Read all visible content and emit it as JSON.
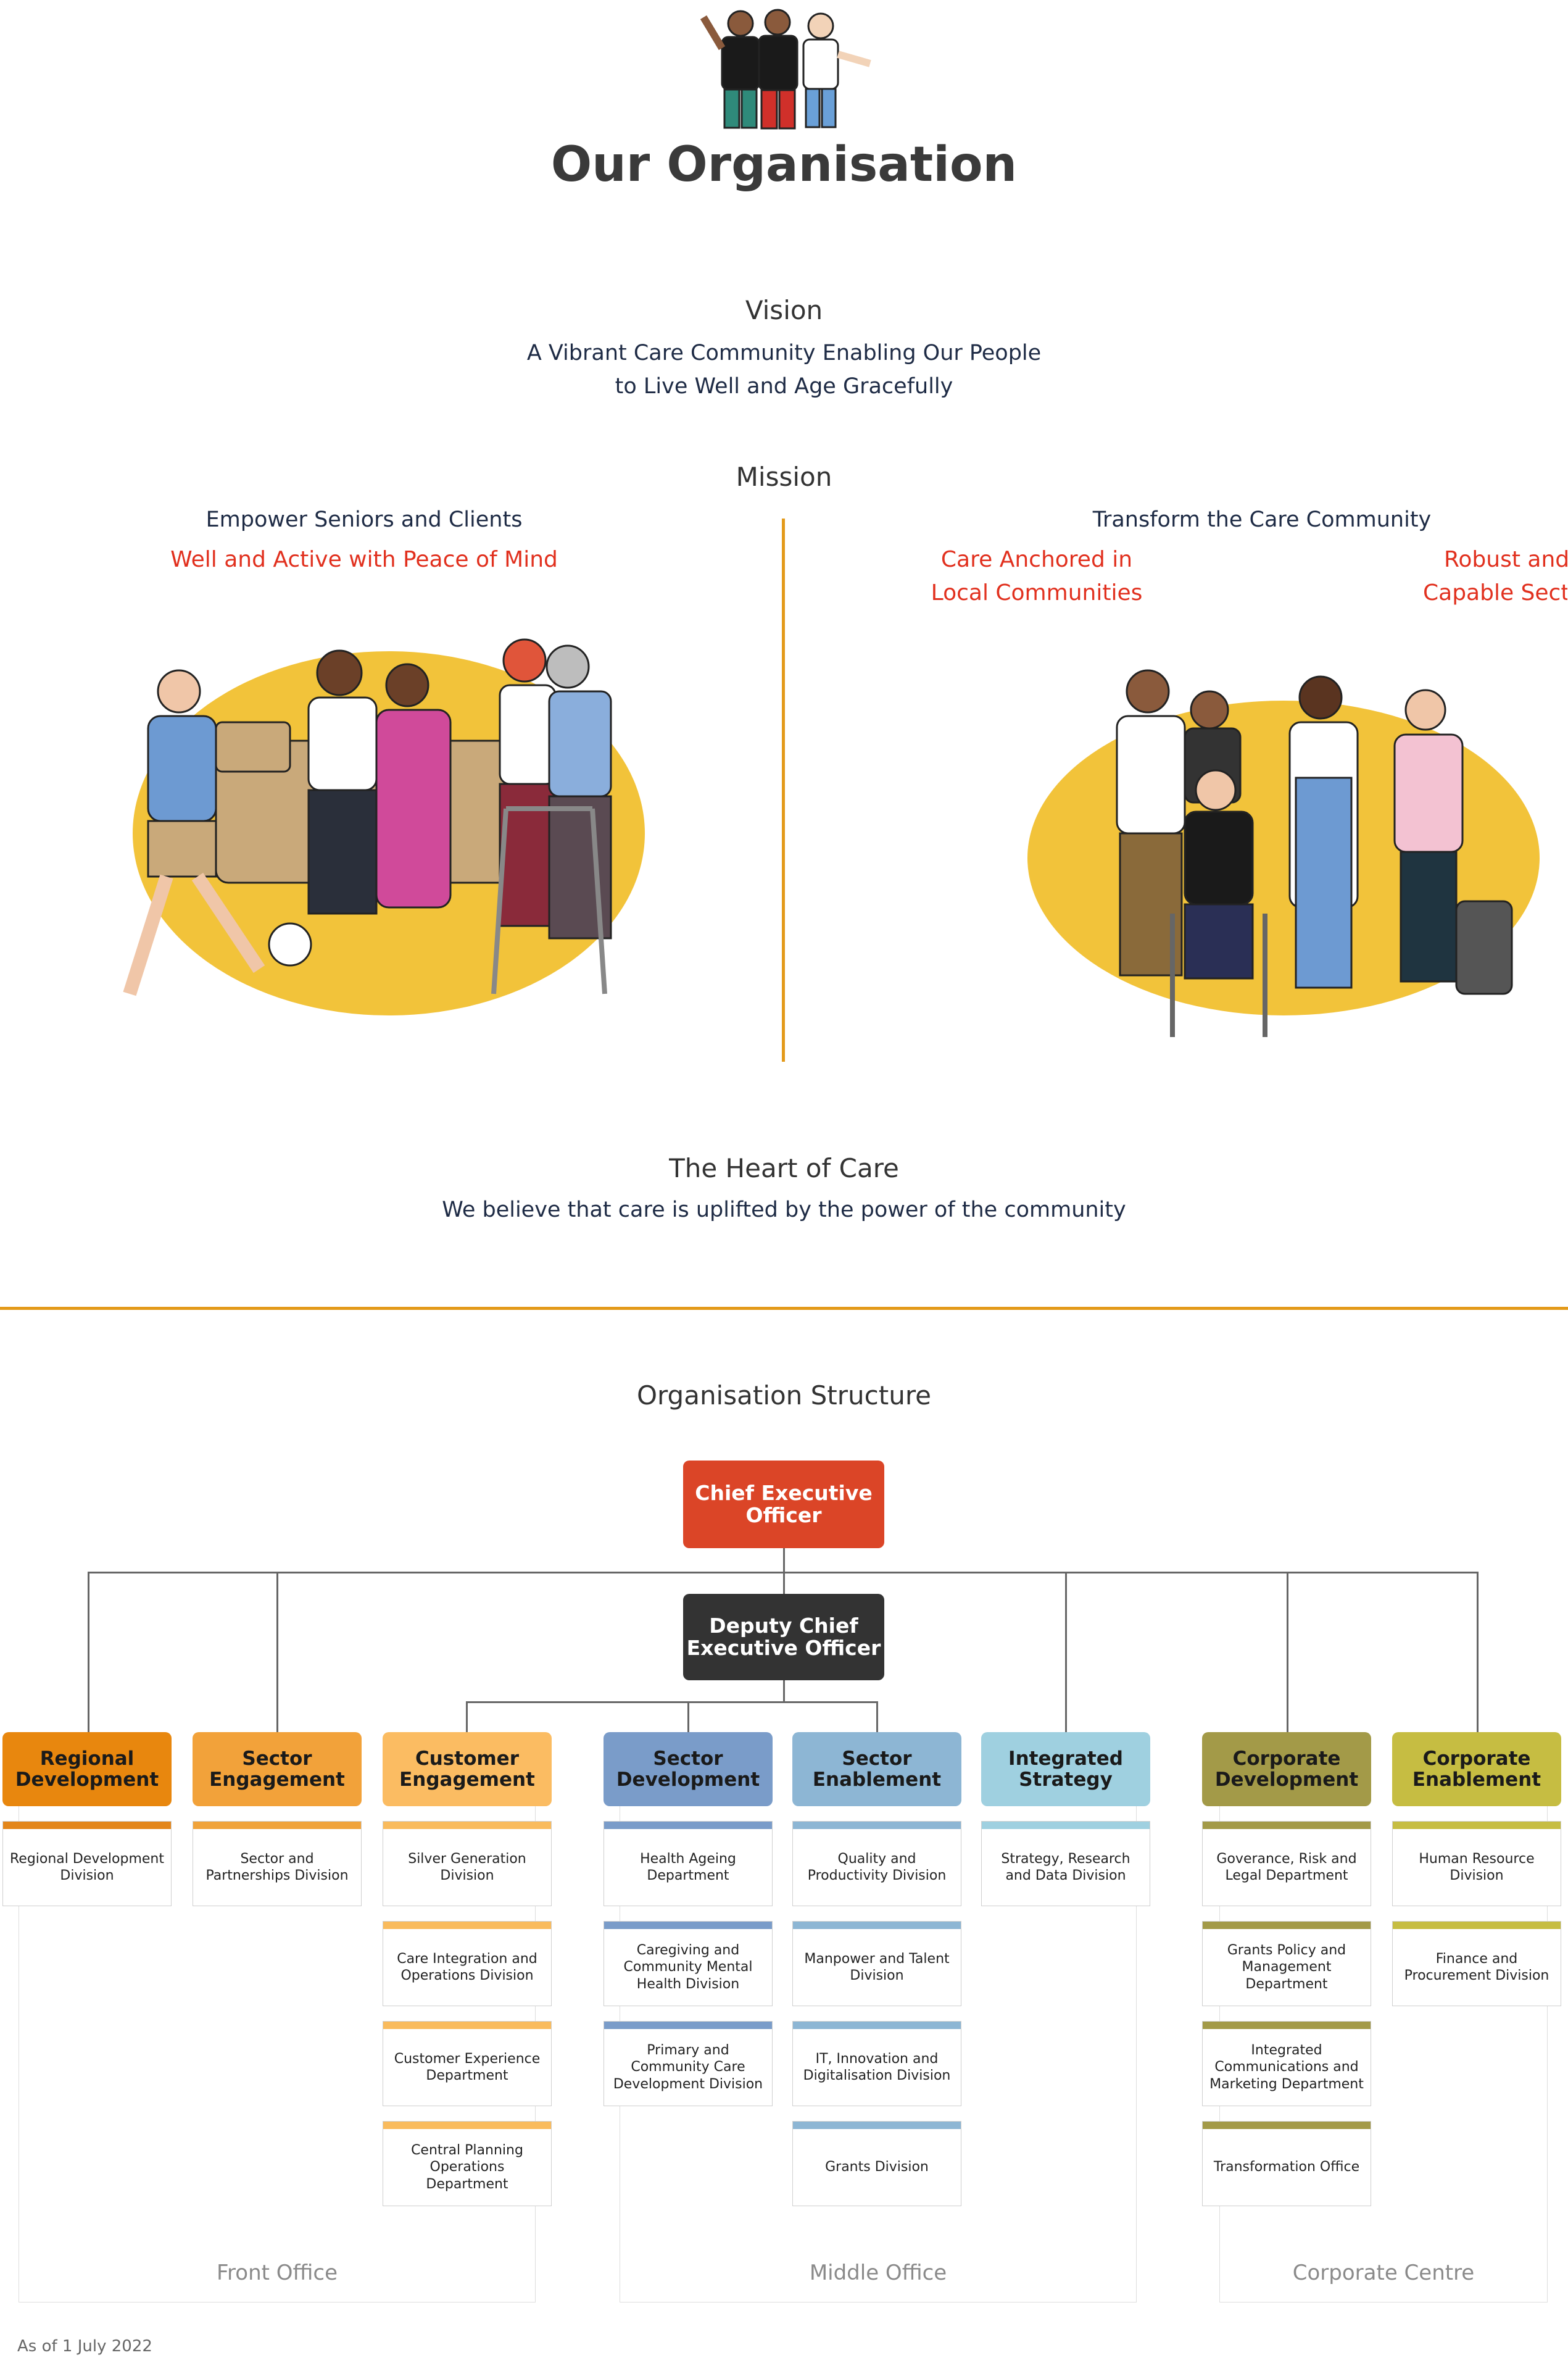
{
  "header": {
    "title": "Our Organisation"
  },
  "vision": {
    "heading": "Vision",
    "line1": "A Vibrant Care Community Enabling Our People",
    "line2": "to Live Well and Age Gracefully"
  },
  "mission": {
    "heading": "Mission",
    "left": {
      "title": "Empower Seniors and Clients",
      "subtitle": "Well and Active with Peace of Mind"
    },
    "right": {
      "title": "Transform the Care Community",
      "point1_line1": "Care Anchored in",
      "point1_line2": "Local Communities",
      "point2_line1": "Robust and",
      "point2_line2": "Capable Sect"
    }
  },
  "heart": {
    "heading": "The Heart of Care",
    "text": "We believe that care is uplifted by the power of the community"
  },
  "org": {
    "heading": "Organisation Structure",
    "ceo": "Chief Executive Officer",
    "dceo": "Deputy Chief Executive Officer",
    "groups": [
      {
        "label": "Regional Development",
        "color": "#e8870e",
        "bar": "#e3861a",
        "divisions": [
          "Regional Development Division"
        ]
      },
      {
        "label": "Sector Engagement",
        "color": "#f2a23a",
        "bar": "#f0a33b",
        "divisions": [
          "Sector and Partnerships Division"
        ]
      },
      {
        "label": "Customer Engagement",
        "color": "#fbbc62",
        "bar": "#f9bb5d",
        "divisions": [
          "Silver Generation Division",
          "Care Integration and Operations Division",
          "Customer Experience Department",
          "Central Planning Operations Department"
        ]
      },
      {
        "label": "Sector Development",
        "color": "#7a9cc9",
        "bar": "#7a9cc9",
        "divisions": [
          "Health Ageing Department",
          "Caregiving and Community Mental Health Division",
          "Primary and Community Care Development Division"
        ]
      },
      {
        "label": "Sector Enablement",
        "color": "#8db6d4",
        "bar": "#8db6d4",
        "divisions": [
          "Quality and Productivity Division",
          "Manpower and Talent Division",
          "IT, Innovation and Digitalisation Division",
          "Grants Division"
        ]
      },
      {
        "label": "Integrated Strategy",
        "color": "#9fd0e0",
        "bar": "#9fd0e0",
        "divisions": [
          "Strategy, Research and Data Division"
        ]
      },
      {
        "label": "Corporate Development",
        "color": "#a39a48",
        "bar": "#a39a48",
        "divisions": [
          "Goverance, Risk and Legal Department",
          "Grants Policy and Management Department",
          "Integrated Communications and Marketing Department",
          "Transformation Office"
        ]
      },
      {
        "label": "Corporate Enablement",
        "color": "#c6bd42",
        "bar": "#c6bd42",
        "divisions": [
          "Human Resource Division",
          "Finance and Procurement Division"
        ]
      }
    ],
    "offices": [
      "Front Office",
      "Middle Office",
      "Corporate Centre"
    ]
  },
  "footer": {
    "as_of": "As of 1 July 2022"
  }
}
